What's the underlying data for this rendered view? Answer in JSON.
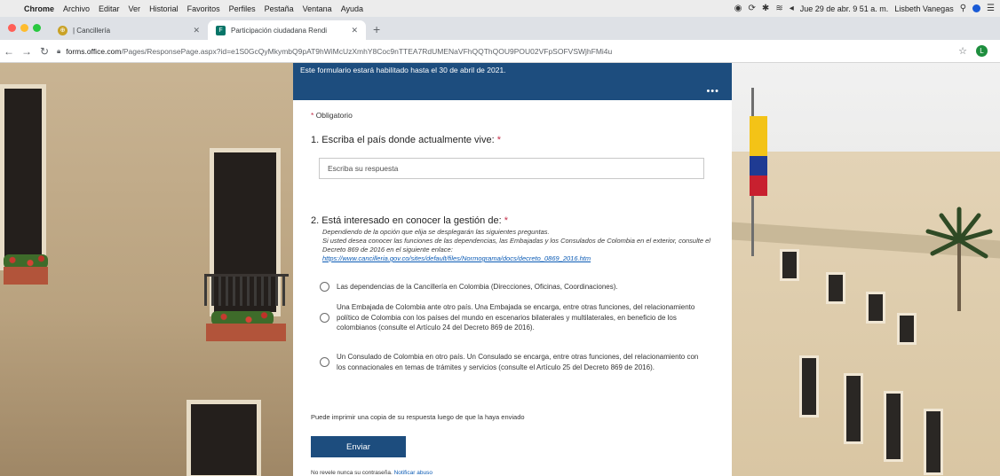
{
  "menubar": {
    "app_name": "Chrome",
    "items": [
      "Archivo",
      "Editar",
      "Ver",
      "Historial",
      "Favoritos",
      "Perfiles",
      "Pestaña",
      "Ventana",
      "Ayuda"
    ],
    "datetime": "Jue 29 de abr. 9 51 a. m.",
    "user": "Lisbeth Vanegas"
  },
  "tabs": [
    {
      "label": "| Cancillería",
      "active": false
    },
    {
      "label": "Participación ciudadana Rendi",
      "active": true
    }
  ],
  "toolbar": {
    "url_host": "forms.office.com",
    "url_path": "/Pages/ResponsePage.aspx?id=e1S0GcQyMkymbQ9pAT9hWiMcUzXmhY8Coc9nTTEA7RdUMENaVFhQQThQOU9POU02VFpSOFVSWjhFMi4u",
    "profile_initial": "L"
  },
  "form": {
    "header_text": "Este formulario estará habilitado hasta el 30 de abril de 2021.",
    "required_label": "Obligatorio",
    "q1": {
      "title": "1. Escriba el país donde actualmente vive:",
      "placeholder": "Escriba su respuesta"
    },
    "q2": {
      "title": "2. Está interesado en conocer la gestión de:",
      "description_lines": [
        "Dependiendo de la opción que elija se desplegarán las siguientes preguntas.",
        "Si usted desea conocer las funciones de las dependencias, las Embajadas y los Consulados de Colombia en el exterior, consulte el Decreto 869 de 2016 en el siguiente enlace:"
      ],
      "link": "https://www.cancilleria.gov.co/sites/default/files/Normograma/docs/decreto_0869_2016.htm",
      "options": [
        "Las dependencias de la Cancillería en Colombia (Direcciones, Oficinas, Coordinaciones).",
        "Una Embajada de Colombia ante otro país. Una Embajada se encarga, entre otras funciones, del relacionamiento político de Colombia con los países del mundo en escenarios bilaterales y multilaterales, en beneficio de los colombianos (consulte el Artículo 24 del Decreto 869 de 2016).",
        "Un Consulado de Colombia en otro país. Un Consulado se encarga, entre otras funciones, del relacionamiento con los connacionales en temas de trámites y servicios (consulte el Artículo 25 del Decreto 869 de 2016)."
      ]
    },
    "print_note": "Puede imprimir una copia de su respuesta luego de que la haya enviado",
    "submit_label": "Enviar",
    "footer_text": "No revele nunca su contraseña.",
    "footer_link": "Notificar abuso"
  },
  "colors": {
    "brand_blue": "#1d4d7e",
    "required_red": "#c4314b",
    "link_blue": "#0b5bb5"
  }
}
